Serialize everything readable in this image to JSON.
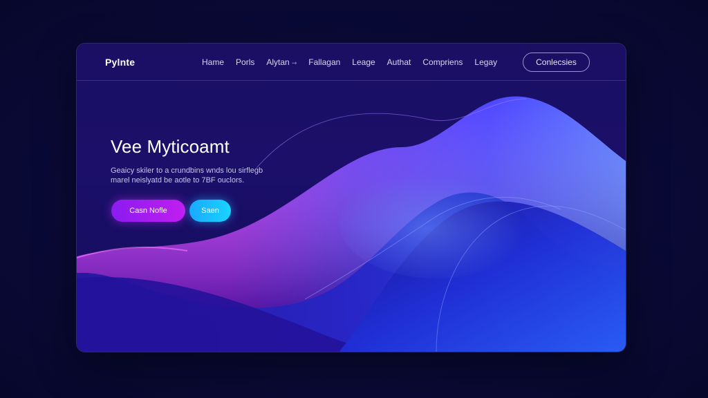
{
  "header": {
    "logo": "Pylnte",
    "nav": [
      {
        "label": "Hame"
      },
      {
        "label": "Porls"
      },
      {
        "label": "Alytan"
      },
      {
        "label": "Fallagan"
      },
      {
        "label": "Leage"
      },
      {
        "label": "Authat"
      },
      {
        "label": "Compriens"
      },
      {
        "label": "Legay"
      }
    ],
    "dropdown_caret": "⇾",
    "contact_label": "Conlecsies"
  },
  "hero": {
    "title": "Vee Myticoamt",
    "subtitle_line1": "Geaicy skiler to a crundbins wnds lou sirflegb",
    "subtitle_line2": "marel neislyatd be aotle to 7BF ouclors.",
    "primary_button": "Casn Nofle",
    "secondary_button": "Saen"
  },
  "colors": {
    "background": "#0a0a36",
    "panel": "#1a0f63",
    "accent_magenta": "#c11ef0",
    "accent_cyan": "#19d4ff"
  }
}
